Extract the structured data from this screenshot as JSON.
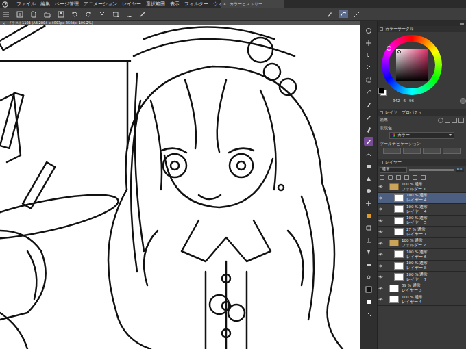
{
  "menu": [
    "ファイル",
    "編集",
    "ページ管理",
    "アニメーション",
    "レイヤー",
    "選択範囲",
    "表示",
    "フィルター",
    "ウィンド"
  ],
  "floating_tab": {
    "close": "×",
    "title": "カラーヒストリー"
  },
  "canvas_tab": {
    "close": "×",
    "title": "イラスト1104 (A4 2894 x 4093px 350dpi 106.2%)"
  },
  "tools": [
    {
      "selected": false
    },
    {
      "selected": false
    },
    {
      "selected": false
    },
    {
      "selected": false
    },
    {
      "selected": false
    },
    {
      "selected": false
    },
    {
      "selected": false
    },
    {
      "selected": false
    },
    {
      "selected": false
    },
    {
      "selected": true
    },
    {
      "selected": false
    },
    {
      "selected": false
    },
    {
      "selected": false
    },
    {
      "selected": false
    },
    {
      "selected": false
    },
    {
      "selected": false
    },
    {
      "selected": false
    },
    {
      "selected": false
    },
    {
      "selected": false
    },
    {
      "selected": false
    },
    {
      "selected": false
    },
    {
      "selected": false
    },
    {
      "selected": false
    },
    {
      "selected": false
    }
  ],
  "color_panel": {
    "title": "カラーサークル",
    "readout": [
      "342",
      "6",
      "96"
    ]
  },
  "layer_property": {
    "title": "レイヤープロパティ",
    "effect_label": "効果",
    "color_label": "表現色",
    "color_value": "カラー",
    "tool_nav": "ツールナビゲーション"
  },
  "layers_panel": {
    "title": "レイヤー",
    "blend": "通常",
    "opacity": "100",
    "layers": [
      {
        "opacity": "100 %",
        "blend": "通常",
        "name": "フォルダー 1",
        "kind": "folder",
        "nested": false,
        "visible": true,
        "selected": false
      },
      {
        "opacity": "100 %",
        "blend": "通常",
        "name": "レイヤー 4",
        "kind": "layer",
        "nested": true,
        "visible": true,
        "selected": true
      },
      {
        "opacity": "100 %",
        "blend": "通常",
        "name": "レイヤー 4",
        "kind": "layer",
        "nested": true,
        "visible": true,
        "selected": false
      },
      {
        "opacity": "100 %",
        "blend": "通常",
        "name": "レイヤー 5",
        "kind": "layer",
        "nested": true,
        "visible": true,
        "selected": false
      },
      {
        "opacity": "27 %",
        "blend": "通常",
        "name": "レイヤー 1",
        "kind": "layer",
        "nested": true,
        "visible": true,
        "selected": false
      },
      {
        "opacity": "100 %",
        "blend": "通常",
        "name": "フォルダー 2",
        "kind": "folder",
        "nested": false,
        "visible": true,
        "selected": false
      },
      {
        "opacity": "100 %",
        "blend": "通常",
        "name": "レイヤー 6",
        "kind": "layer",
        "nested": true,
        "visible": true,
        "selected": false
      },
      {
        "opacity": "100 %",
        "blend": "通常",
        "name": "レイヤー 8",
        "kind": "layer",
        "nested": true,
        "visible": true,
        "selected": false
      },
      {
        "opacity": "100 %",
        "blend": "通常",
        "name": "レイヤー 7",
        "kind": "layer",
        "nested": true,
        "visible": true,
        "selected": false
      },
      {
        "opacity": "39 %",
        "blend": "通常",
        "name": "レイヤー 3",
        "kind": "layer",
        "nested": false,
        "visible": true,
        "selected": false
      },
      {
        "opacity": "100 %",
        "blend": "通常",
        "name": "レイヤー 4",
        "kind": "layer",
        "nested": false,
        "visible": true,
        "selected": false
      }
    ]
  }
}
